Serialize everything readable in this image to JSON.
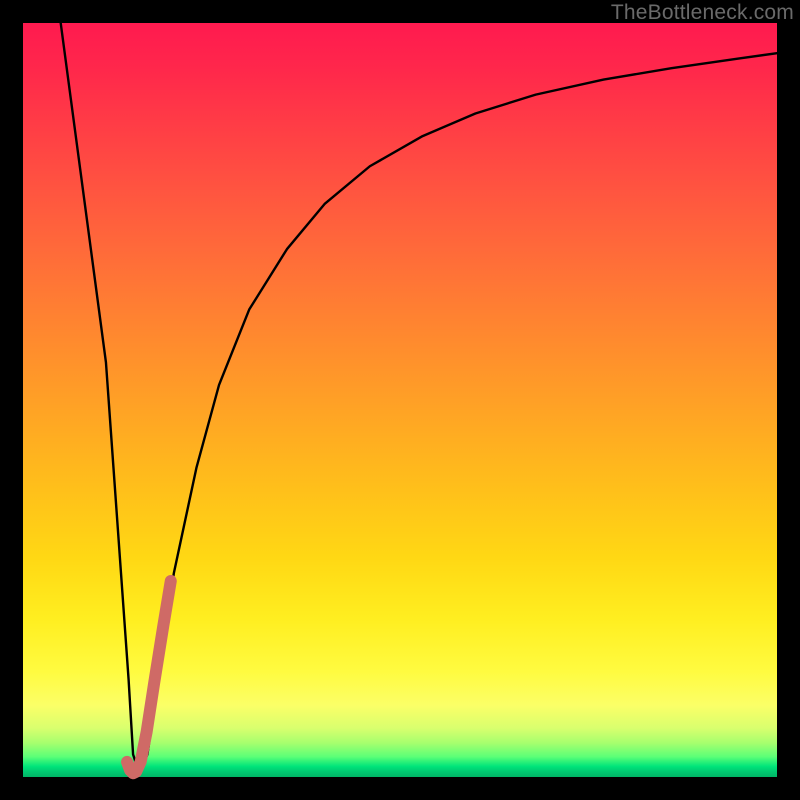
{
  "watermark": "TheBottleneck.com",
  "colors": {
    "frame": "#000000",
    "curve": "#000000",
    "highlight": "#cf6a66",
    "gradient_top": "#ff1a4f",
    "gradient_bottom": "#00b566"
  },
  "chart_data": {
    "type": "line",
    "title": "",
    "xlabel": "",
    "ylabel": "",
    "xlim": [
      0,
      100
    ],
    "ylim": [
      0,
      100
    ],
    "grid": false,
    "legend": false,
    "series": [
      {
        "name": "bottleneck-curve",
        "color": "#000000",
        "x": [
          5,
          7,
          9,
          11,
          12,
          13,
          14,
          14.6,
          15.4,
          16.5,
          18,
          20,
          23,
          26,
          30,
          35,
          40,
          46,
          53,
          60,
          68,
          77,
          86,
          95,
          100
        ],
        "y": [
          100,
          85,
          70,
          55,
          41,
          27,
          13,
          3,
          0.5,
          3,
          13,
          27,
          41,
          52,
          62,
          70,
          76,
          81,
          85,
          88,
          90.5,
          92.5,
          94,
          95.3,
          96
        ]
      },
      {
        "name": "highlight-segment",
        "color": "#cf6a66",
        "x": [
          13.8,
          14.2,
          14.6,
          15.0,
          15.6,
          16.4,
          17.4,
          18.6,
          19.6
        ],
        "y": [
          2.0,
          0.9,
          0.5,
          0.7,
          2.0,
          6.0,
          12.5,
          20.0,
          26.0
        ]
      }
    ],
    "annotations": [
      {
        "text": "TheBottleneck.com",
        "position": "top-right"
      }
    ]
  }
}
